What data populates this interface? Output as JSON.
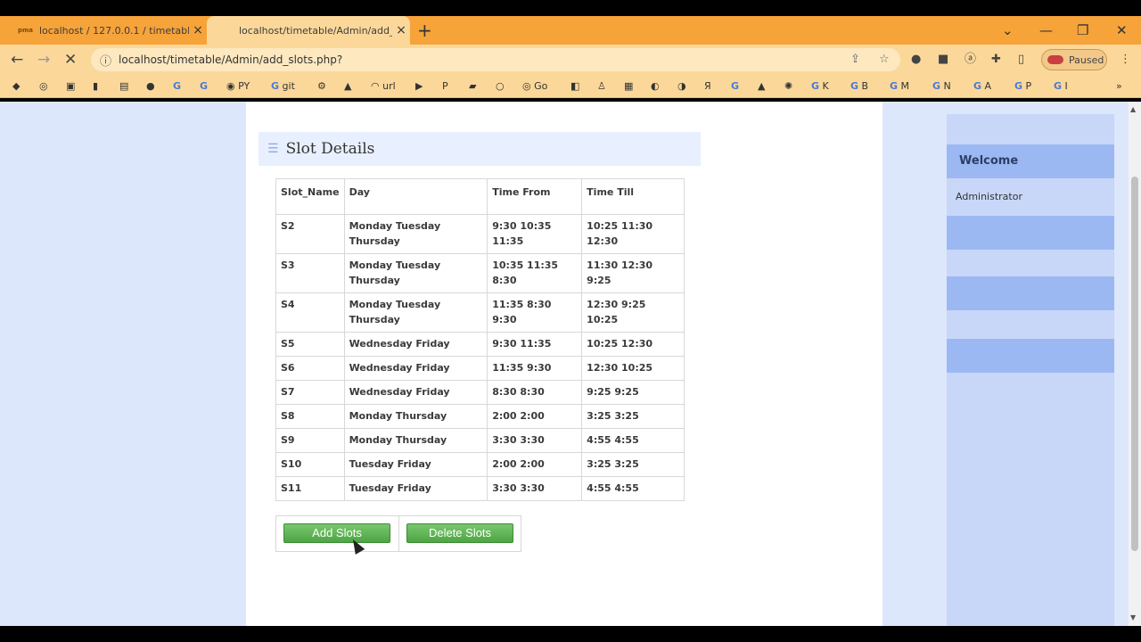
{
  "browser": {
    "tabs": [
      {
        "title": "localhost / 127.0.0.1 / timetable",
        "favicon": "pma",
        "active": false
      },
      {
        "title": "localhost/timetable/Admin/add_",
        "favicon": "",
        "active": true
      }
    ],
    "url": "localhost/timetable/Admin/add_slots.php?",
    "profile_label": "Paused",
    "bookmarks": [
      "PY",
      "git",
      "url",
      "Go",
      "K",
      "B",
      "M",
      "N",
      "A",
      "P",
      "I"
    ]
  },
  "page": {
    "heading": "Slot Details",
    "table": {
      "headers": [
        "Slot_Name",
        "Day",
        "Time From",
        "Time Till"
      ],
      "rows": [
        [
          "S2",
          "Monday Tuesday Thursday",
          "9:30 10:35 11:35",
          "10:25 11:30 12:30"
        ],
        [
          "S3",
          "Monday Tuesday Thursday",
          "10:35 11:35 8:30",
          "11:30 12:30 9:25"
        ],
        [
          "S4",
          "Monday Tuesday Thursday",
          "11:35 8:30 9:30",
          "12:30 9:25 10:25"
        ],
        [
          "S5",
          "Wednesday Friday",
          "9:30 11:35",
          "10:25 12:30"
        ],
        [
          "S6",
          "Wednesday Friday",
          "11:35 9:30",
          "12:30 10:25"
        ],
        [
          "S7",
          "Wednesday Friday",
          "8:30 8:30",
          "9:25 9:25"
        ],
        [
          "S8",
          "Monday Thursday",
          "2:00 2:00",
          "3:25 3:25"
        ],
        [
          "S9",
          "Monday Thursday",
          "3:30 3:30",
          "4:55 4:55"
        ],
        [
          "S10",
          "Tuesday Friday",
          "2:00 2:00",
          "3:25 3:25"
        ],
        [
          "S11",
          "Tuesday Friday",
          "3:30 3:30",
          "4:55 4:55"
        ]
      ]
    },
    "buttons": {
      "add": "Add Slots",
      "delete": "Delete Slots"
    },
    "sidebar": {
      "welcome": "Welcome",
      "user": "Administrator"
    }
  },
  "colors": {
    "accent": "#f6a33a",
    "sidebar": "#c8d7f8",
    "button": "#4da543"
  }
}
